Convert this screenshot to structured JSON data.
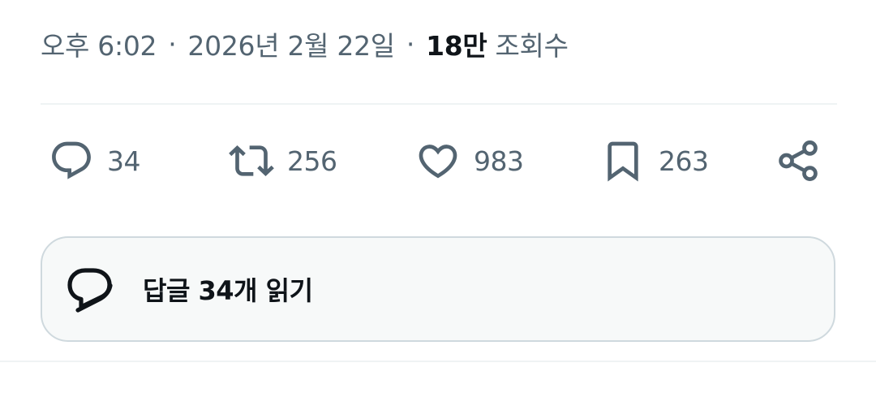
{
  "meta": {
    "time": "오후 6:02",
    "separator": "·",
    "date": "2026년 2월 22일",
    "views_count": "18만",
    "views_label": "조회수"
  },
  "actions": {
    "reply": {
      "icon": "reply-icon",
      "count": "34"
    },
    "retweet": {
      "icon": "retweet-icon",
      "count": "256"
    },
    "like": {
      "icon": "heart-icon",
      "count": "983"
    },
    "bookmark": {
      "icon": "bookmark-icon",
      "count": "263"
    },
    "share": {
      "icon": "share-icon"
    }
  },
  "replies": {
    "icon": "replies-bubble-icon",
    "label": "답글 34개 읽기"
  },
  "colors": {
    "secondary_text": "#536471",
    "primary_text": "#0f1419",
    "border": "#cfd9de",
    "box_bg": "#f7f9f9",
    "divider": "#eff3f4"
  }
}
